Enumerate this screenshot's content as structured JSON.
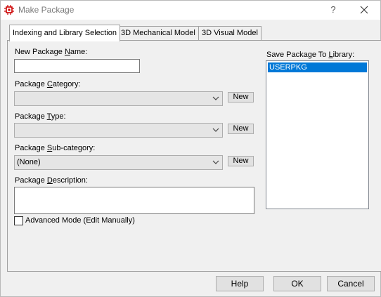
{
  "window": {
    "title": "Make Package",
    "help_glyph": "?",
    "icon": "chip-icon",
    "accent_color": "#cc0000"
  },
  "tabs": [
    {
      "label": "Indexing and Library Selection",
      "active": true
    },
    {
      "label": "3D Mechanical Model",
      "active": false
    },
    {
      "label": "3D Visual Model",
      "active": false
    }
  ],
  "form": {
    "name": {
      "pre": "New Package ",
      "ul": "N",
      "post": "ame:",
      "value": ""
    },
    "category": {
      "pre": "Package ",
      "ul": "C",
      "post": "ategory:",
      "value": "",
      "new_label": "New"
    },
    "type": {
      "pre": "Package ",
      "ul": "T",
      "post": "ype:",
      "value": "",
      "new_label": "New"
    },
    "subcategory": {
      "pre": "Package ",
      "ul": "S",
      "post": "ub-category:",
      "value": "(None)",
      "new_label": "New"
    },
    "description": {
      "pre": "Package ",
      "ul": "D",
      "post": "escription:",
      "value": ""
    },
    "advanced": {
      "label": "Advanced Mode (Edit Manually)",
      "checked": false
    }
  },
  "library": {
    "label_pre": "Save Package To ",
    "label_ul": "L",
    "label_post": "ibrary:",
    "items": [
      "USERPKG"
    ],
    "selected_color": "#0078d7"
  },
  "buttons": {
    "help": "Help",
    "ok": "OK",
    "cancel": "Cancel"
  }
}
